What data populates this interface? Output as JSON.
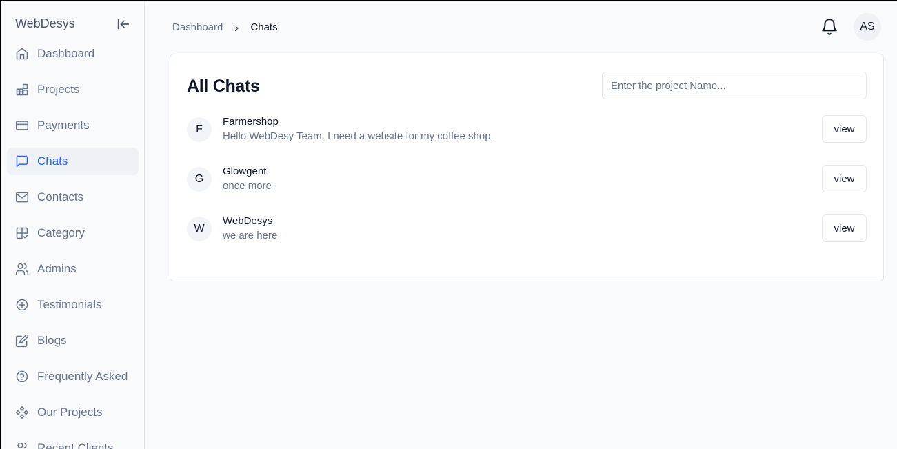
{
  "app": {
    "brand": "WebDesys"
  },
  "sidebar": {
    "items": [
      {
        "label": "Dashboard",
        "icon": "home-icon",
        "active": false
      },
      {
        "label": "Projects",
        "icon": "projects-icon",
        "active": false
      },
      {
        "label": "Payments",
        "icon": "credit-card-icon",
        "active": false
      },
      {
        "label": "Chats",
        "icon": "message-square-icon",
        "active": true
      },
      {
        "label": "Contacts",
        "icon": "mail-icon",
        "active": false
      },
      {
        "label": "Category",
        "icon": "category-icon",
        "active": false
      },
      {
        "label": "Admins",
        "icon": "users-icon",
        "active": false
      },
      {
        "label": "Testimonials",
        "icon": "plus-circle-icon",
        "active": false
      },
      {
        "label": "Blogs",
        "icon": "edit-icon",
        "active": false
      },
      {
        "label": "Frequently Asked",
        "icon": "help-circle-icon",
        "active": false
      },
      {
        "label": "Our Projects",
        "icon": "component-icon",
        "active": false
      },
      {
        "label": "Recent Clients",
        "icon": "users-icon",
        "active": false
      }
    ]
  },
  "header": {
    "breadcrumb": {
      "parent": "Dashboard",
      "current": "Chats"
    },
    "avatar_initials": "AS"
  },
  "main": {
    "title": "All Chats",
    "search_placeholder": "Enter the project Name...",
    "chats": [
      {
        "initial": "F",
        "name": "Farmershop",
        "message": "Hello WebDesy Team, I need a website for my coffee shop.",
        "action": "view"
      },
      {
        "initial": "G",
        "name": "Glowgent",
        "message": "once more",
        "action": "view"
      },
      {
        "initial": "W",
        "name": "WebDesys",
        "message": "we are here",
        "action": "view"
      }
    ]
  },
  "colors": {
    "accent": "#2563eb",
    "active_bg": "#eef2f7",
    "muted_text": "#64748b"
  }
}
